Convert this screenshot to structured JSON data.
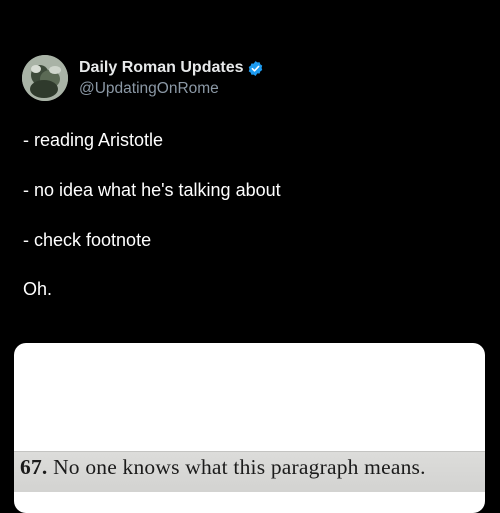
{
  "tweet": {
    "display_name": "Daily Roman Updates",
    "handle": "@UpdatingOnRome",
    "verified": true,
    "avatar_icon": "roman-bust-avatar",
    "lines": [
      "- reading Aristotle",
      "- no idea what he's talking about",
      "- check footnote",
      "Oh."
    ]
  },
  "media": {
    "footnote_number": "67.",
    "footnote_text": "No one knows what this paragraph means."
  },
  "colors": {
    "background": "#000000",
    "text": "#ffffff",
    "secondary_text": "#8b98a5",
    "verified_blue": "#1d9bf0"
  }
}
